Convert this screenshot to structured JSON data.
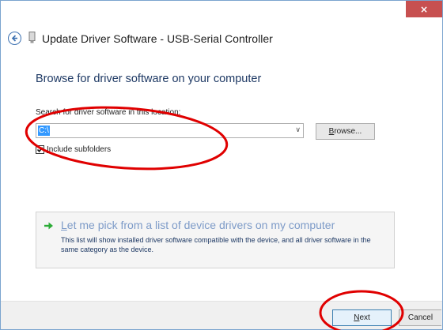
{
  "window": {
    "title": "Update Driver Software - USB-Serial Controller",
    "close_glyph": "×"
  },
  "main": {
    "heading": "Browse for driver software on your computer",
    "search_label": "Search for driver software in this location:",
    "path_value": "C:\\",
    "browse_label_accel": "B",
    "browse_label_rest": "rowse...",
    "include_subfolders_accel": "I",
    "include_subfolders_rest": "nclude subfolders",
    "include_subfolders_checked": true
  },
  "pick_option": {
    "title_accel": "L",
    "title_rest": "et me pick from a list of device drivers on my computer",
    "description": "This list will show installed driver software compatible with the device, and all driver software in the same category as the device."
  },
  "footer": {
    "next_accel": "N",
    "next_rest": "ext",
    "cancel_label": "Cancel"
  },
  "icons": {
    "back": "back-arrow-icon",
    "device": "usb-device-icon",
    "pick": "green-arrow-icon"
  },
  "colors": {
    "close_button": "#c75050",
    "heading": "#1e3964",
    "selection": "#3399ff",
    "pick_title": "#7d9bc8",
    "annotation": "#e00000"
  }
}
